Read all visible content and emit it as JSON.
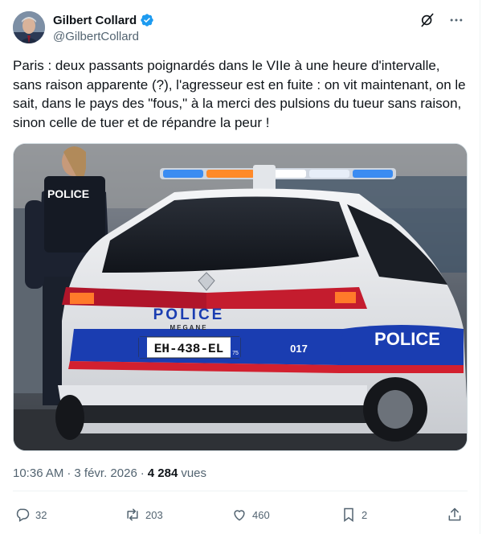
{
  "author": {
    "name": "Gilbert Collard",
    "handle": "@GilbertCollard"
  },
  "icons": {
    "verified": "verified-badge-icon",
    "grok": "grok-icon",
    "more": "more-icon"
  },
  "tweet": {
    "text": "Paris : deux passants poignardés dans le VIIe à une heure d'intervalle, sans raison apparente (?), l'agresseur est en fuite : on vit maintenant, on le sait, dans le pays des \"fous,\" à la merci des pulsions du tueur sans raison, sinon celle de tuer et de répandre la peur !"
  },
  "media": {
    "police_text": "POLICE",
    "model_text": "MEGANE",
    "plate": "EH-438-EL",
    "plate_dept": "75",
    "code": "017",
    "vest_text": "POLICE"
  },
  "meta": {
    "time": "10:36 AM",
    "sep": "·",
    "date": "3 févr. 2026",
    "sep2": "·",
    "views_count": "4 284",
    "views_label": "vues"
  },
  "actions": {
    "replies": "32",
    "reposts": "203",
    "likes": "460",
    "bookmarks": "2"
  },
  "colors": {
    "accent": "#1d9bf0",
    "text": "#0f1419",
    "muted": "#536471"
  }
}
